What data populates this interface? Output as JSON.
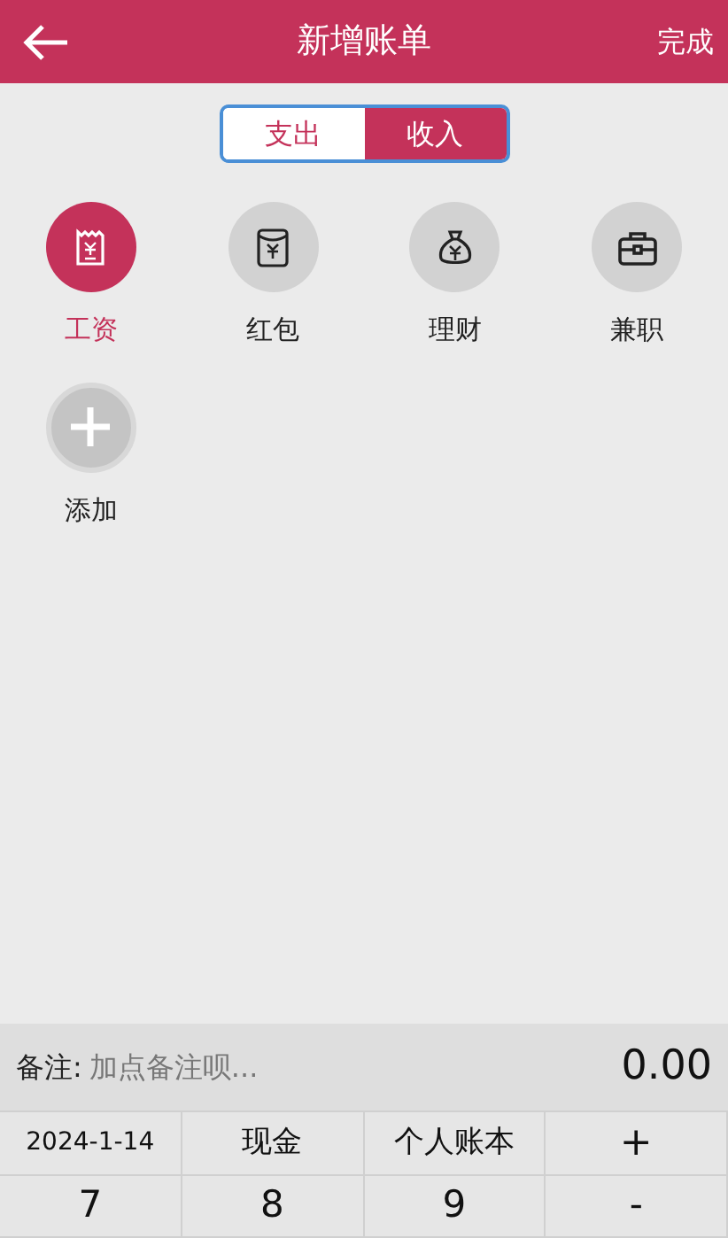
{
  "header": {
    "title": "新增账单",
    "action": "完成"
  },
  "tabs": [
    {
      "label": "支出",
      "selected": false
    },
    {
      "label": "收入",
      "selected": true
    }
  ],
  "categories": [
    {
      "kind": "salary",
      "label": "工资",
      "selected": true
    },
    {
      "kind": "red-packet",
      "label": "红包",
      "selected": false
    },
    {
      "kind": "finance",
      "label": "理财",
      "selected": false
    },
    {
      "kind": "part-time",
      "label": "兼职",
      "selected": false
    },
    {
      "kind": "add",
      "label": "添加",
      "selected": false
    }
  ],
  "note": {
    "label": "备注:",
    "placeholder": "加点备注呗...",
    "amount": "0.00"
  },
  "keypad": [
    [
      "2024-1-14",
      "现金",
      "个人账本",
      "+"
    ],
    [
      "7",
      "8",
      "9",
      "-"
    ]
  ]
}
